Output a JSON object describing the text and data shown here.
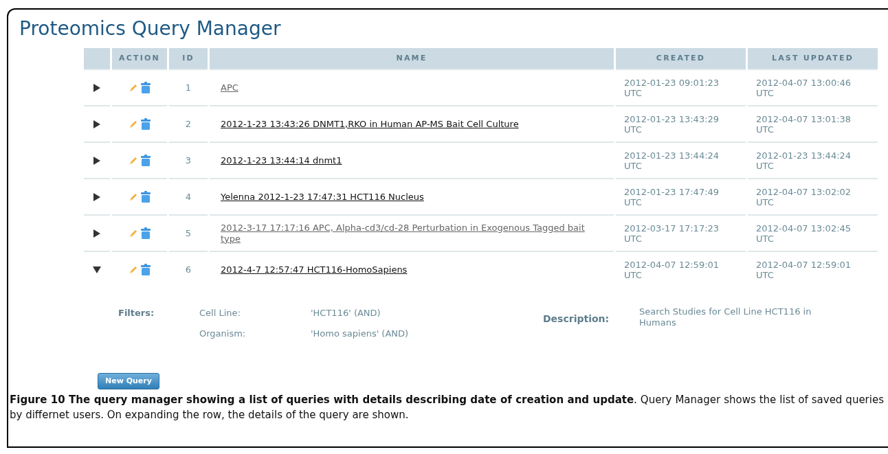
{
  "title": "Proteomics Query Manager",
  "table": {
    "columns": [
      "",
      "ACTION",
      "ID",
      "NAME",
      "CREATED",
      "LAST UPDATED"
    ],
    "rows": [
      {
        "expanded": false,
        "visited": true,
        "id": "1",
        "name": "APC",
        "created": "2012-01-23 09:01:23 UTC",
        "updated": "2012-04-07 13:00:46 UTC"
      },
      {
        "expanded": false,
        "visited": false,
        "id": "2",
        "name": "2012-1-23 13:43:26 DNMT1,RKO in Human AP-MS Bait Cell Culture",
        "created": "2012-01-23 13:43:29 UTC",
        "updated": "2012-04-07 13:01:38 UTC"
      },
      {
        "expanded": false,
        "visited": false,
        "id": "3",
        "name": "2012-1-23 13:44:14 dnmt1",
        "created": "2012-01-23 13:44:24 UTC",
        "updated": "2012-01-23 13:44:24 UTC"
      },
      {
        "expanded": false,
        "visited": false,
        "id": "4",
        "name": "Yelenna 2012-1-23 17:47:31 HCT116 Nucleus",
        "created": "2012-01-23 17:47:49 UTC",
        "updated": "2012-04-07 13:02:02 UTC"
      },
      {
        "expanded": false,
        "visited": true,
        "id": "5",
        "name": "2012-3-17 17:17:16 APC, Alpha-cd3/cd-28 Perturbation in Exogenous Tagged bait type",
        "created": "2012-03-17 17:17:23 UTC",
        "updated": "2012-04-07 13:02:45 UTC"
      },
      {
        "expanded": true,
        "visited": false,
        "id": "6",
        "name": "2012-4-7 12:57:47 HCT116-HomoSapiens",
        "created": "2012-04-07 12:59:01 UTC",
        "updated": "2012-04-07 12:59:01 UTC"
      }
    ]
  },
  "details": {
    "filters_label": "Filters:",
    "filters": [
      {
        "label": "Cell Line:",
        "value": "'HCT116' (AND)"
      },
      {
        "label": "Organism:",
        "value": "'Homo sapiens' (AND)"
      }
    ],
    "description_label": "Description:",
    "description": "Search Studies for Cell Line HCT116 in Humans"
  },
  "new_query_button": "New Query",
  "caption": "**Figure 10 The query manager showing a list of queries with details describing date of creation and update**. Query Manager shows the list of saved queries by differnet users. On expanding the row, the details of the query are shown."
}
